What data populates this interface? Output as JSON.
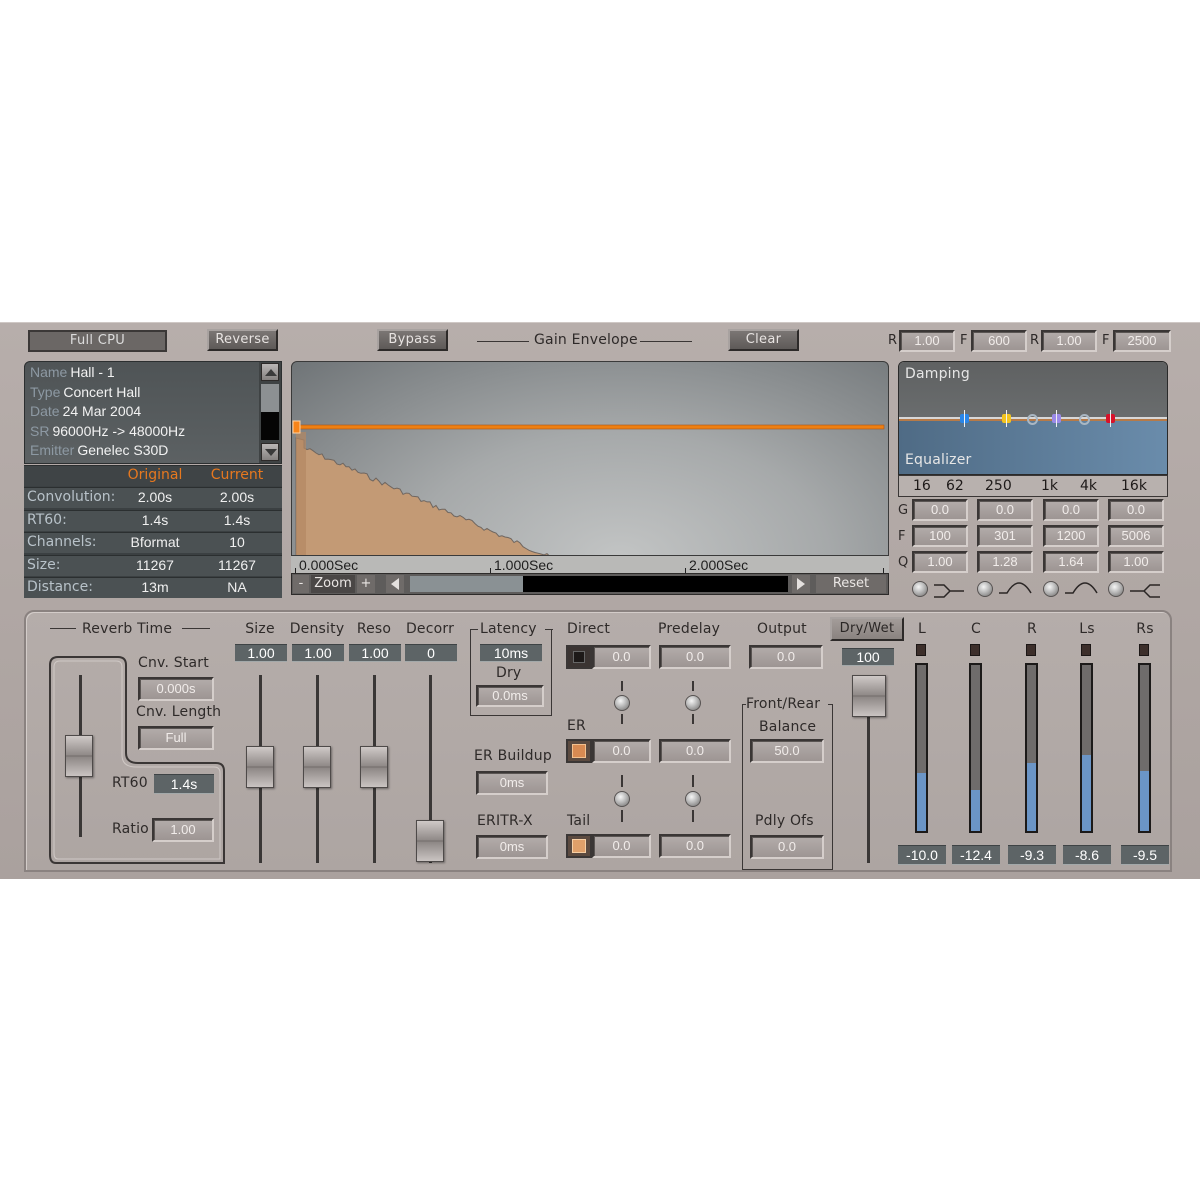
{
  "toolbar": {
    "full_cpu": "Full CPU",
    "reverse": "Reverse",
    "bypass": "Bypass",
    "gain_envelope": "Gain Envelope",
    "clear": "Clear",
    "damping_params": [
      {
        "label": "R",
        "value": "1.00"
      },
      {
        "label": "F",
        "value": "600"
      },
      {
        "label": "R",
        "value": "1.00"
      },
      {
        "label": "F",
        "value": "2500"
      }
    ]
  },
  "info": {
    "rows": [
      {
        "key": "Name",
        "value": "Hall - 1"
      },
      {
        "key": "Type",
        "value": "Concert Hall"
      },
      {
        "key": "Date",
        "value": "24 Mar 2004"
      },
      {
        "key": "SR",
        "value": "96000Hz -> 48000Hz"
      },
      {
        "key": "Emitter",
        "value": "Genelec S30D"
      }
    ]
  },
  "stats": {
    "col_original": "Original",
    "col_current": "Current",
    "rows": [
      {
        "label": "Convolution:",
        "original": "2.00s",
        "current": "2.00s"
      },
      {
        "label": "RT60:",
        "original": "1.4s",
        "current": "1.4s"
      },
      {
        "label": "Channels:",
        "original": "Bformat",
        "current": "10"
      },
      {
        "label": "Size:",
        "original": "11267",
        "current": "11267"
      },
      {
        "label": "Distance:",
        "original": "13m",
        "current": "NA"
      }
    ]
  },
  "envelope": {
    "ticks": [
      "0.000Sec",
      "1.000Sec",
      "2.000Sec"
    ],
    "zoom_minus": "-",
    "zoom_label": "Zoom",
    "zoom_plus": "+",
    "reset": "Reset",
    "scroll_position": 0.3,
    "decay_end_sec": 1.3,
    "total_sec": 2.6
  },
  "eq": {
    "damping_label": "Damping",
    "equalizer_label": "Equalizer",
    "freq_scale": [
      "16",
      "62",
      "250",
      "1k",
      "4k",
      "16k"
    ],
    "band_colors": [
      "#2a86e8",
      "#f2c420",
      "#a9b7c3",
      "#9b8ae8",
      "#a9b7c3",
      "#d8122a"
    ],
    "rows": [
      {
        "label": "G",
        "values": [
          "0.0",
          "0.0",
          "0.0",
          "0.0"
        ]
      },
      {
        "label": "F",
        "values": [
          "100",
          "301",
          "1200",
          "5006"
        ]
      },
      {
        "label": "Q",
        "values": [
          "1.00",
          "1.28",
          "1.64",
          "1.00"
        ]
      }
    ],
    "filter_shapes": [
      "low-shelf-icon",
      "peak-icon",
      "peak-icon",
      "high-shelf-icon"
    ]
  },
  "reverb_time": {
    "title": "Reverb Time",
    "cnv_start_label": "Cnv. Start",
    "cnv_start": "0.000s",
    "cnv_length_label": "Cnv. Length",
    "cnv_length": "Full",
    "rt60_label": "RT60",
    "rt60": "1.4s",
    "ratio_label": "Ratio",
    "ratio": "1.00"
  },
  "faders": [
    {
      "label": "Size",
      "value": "1.00"
    },
    {
      "label": "Density",
      "value": "1.00"
    },
    {
      "label": "Reso",
      "value": "1.00"
    },
    {
      "label": "Decorr",
      "value": "0"
    }
  ],
  "latency": {
    "title": "Latency",
    "value": "10ms",
    "dry_label": "Dry",
    "dry_value": "0.0ms"
  },
  "er_buildup": {
    "label": "ER Buildup",
    "value": "0ms"
  },
  "eritr_x": {
    "label": "ERITR-X",
    "value": "0ms"
  },
  "mix": {
    "direct_label": "Direct",
    "predelay_label": "Predelay",
    "output_label": "Output",
    "er_label": "ER",
    "tail_label": "Tail",
    "direct_value": "0.0",
    "direct_predelay": "0.0",
    "er_value": "0.0",
    "er_predelay": "0.0",
    "tail_value": "0.0",
    "tail_predelay": "0.0",
    "output_value": "0.0"
  },
  "front_rear": {
    "title": "Front/Rear",
    "balance_label": "Balance",
    "balance": "50.0",
    "pdly_label": "Pdly Ofs",
    "pdly": "0.0"
  },
  "dry_wet": {
    "label": "Dry/Wet",
    "value": "100"
  },
  "meters": [
    {
      "label": "L",
      "value": "-10.0",
      "level": 0.35
    },
    {
      "label": "C",
      "value": "-12.4",
      "level": 0.25
    },
    {
      "label": "R",
      "value": "-9.3",
      "level": 0.41
    },
    {
      "label": "Ls",
      "value": "-8.6",
      "level": 0.46
    },
    {
      "label": "Rs",
      "value": "-9.5",
      "level": 0.36
    }
  ]
}
